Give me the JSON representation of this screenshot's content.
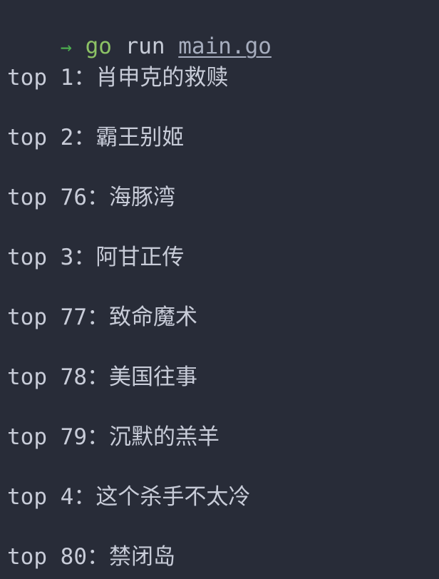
{
  "terminal": {
    "background_color": "#282c38",
    "foreground_color": "#c8ccd8",
    "prompt": {
      "symbol": "→",
      "symbol_color": "#4cae4f",
      "command": "go",
      "command_color": "#8cc265",
      "arg": " run ",
      "arg_color": "#c6cbd6",
      "file": "main.go",
      "file_color": "#a6adbe",
      "full_text": "→ go run main.go"
    },
    "output_lines": [
      {
        "label": "top 1：",
        "title": "肖申克的救赎",
        "rank": 1,
        "text": "top 1：肖申克的救赎"
      },
      {
        "label": "top 2：",
        "title": "霸王别姬",
        "rank": 2,
        "text": "top 2：霸王别姬"
      },
      {
        "label": "top 76：",
        "title": "海豚湾",
        "rank": 76,
        "text": "top 76：海豚湾"
      },
      {
        "label": "top 3：",
        "title": "阿甘正传",
        "rank": 3,
        "text": "top 3：阿甘正传"
      },
      {
        "label": "top 77：",
        "title": "致命魔术",
        "rank": 77,
        "text": "top 77：致命魔术"
      },
      {
        "label": "top 78：",
        "title": "美国往事",
        "rank": 78,
        "text": "top 78：美国往事"
      },
      {
        "label": "top 79：",
        "title": "沉默的羔羊",
        "rank": 79,
        "text": "top 79：沉默的羔羊"
      },
      {
        "label": "top 4：",
        "title": "这个杀手不太冷",
        "rank": 4,
        "text": "top 4：这个杀手不太冷"
      },
      {
        "label": "top 80：",
        "title": "禁闭岛",
        "rank": 80,
        "text": "top 80：禁闭岛"
      }
    ]
  }
}
